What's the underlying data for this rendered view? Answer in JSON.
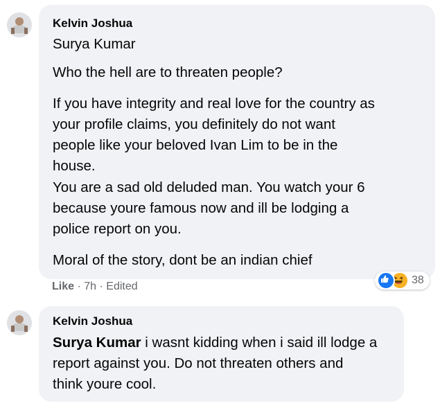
{
  "comments": [
    {
      "author": "Kelvin Joshua",
      "lines": [
        "Surya Kumar",
        "Who the hell are to threaten people?",
        "If you have integrity and real love for the country as",
        "your profile claims, you definitely do not want",
        "people like your beloved Ivan Lim to be in the",
        "house.",
        "You are a sad old deluded man. You watch your 6",
        "because youre famous now and ill be lodging a",
        "police report on you.",
        "Moral of the story, dont be an indian chief"
      ],
      "like_label": "Like",
      "time": "7h",
      "edited": "Edited",
      "separator": "·",
      "reaction_count": "38",
      "reaction_icons": [
        "like-icon",
        "haha-icon"
      ]
    },
    {
      "author": "Kelvin Joshua",
      "mention": "Surya Kumar",
      "lines": [
        " i wasnt kidding when i said ill lodge a",
        "report against you. Do not threaten others and",
        "think youre cool."
      ]
    }
  ],
  "colors": {
    "bubble": "#f0f2f5",
    "text": "#050505",
    "meta": "#65676b",
    "like_blue": "#1877f2",
    "haha_yellow": "#f7b125"
  }
}
